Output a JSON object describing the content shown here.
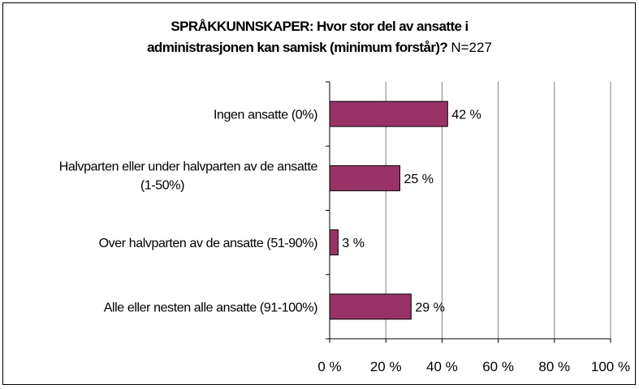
{
  "chart_data": {
    "type": "bar",
    "orientation": "horizontal",
    "title": "SPRÅKKUNNSKAPER: Hvor stor del av ansatte i administrasjonen kan samisk (minimum forstår)?",
    "title_line1": "SPRÅKKUNNSKAPER: Hvor stor del av ansatte i",
    "title_line2": "administrasjonen kan samisk (minimum forstår)?",
    "subtitle": "N=227",
    "categories": [
      [
        "Ingen ansatte (0%)"
      ],
      [
        "Halvparten eller under halvparten av de ansatte",
        "(1-50%)"
      ],
      [
        "Over halvparten av de ansatte (51-90%)"
      ],
      [
        "Alle eller nesten alle ansatte (91-100%)"
      ]
    ],
    "values": [
      42,
      25,
      3,
      29
    ],
    "data_labels": [
      "42 %",
      "25 %",
      "3 %",
      "29 %"
    ],
    "xlim": [
      0,
      100
    ],
    "xticks": [
      0,
      20,
      40,
      60,
      80,
      100
    ],
    "xtick_labels": [
      "0 %",
      "20 %",
      "40 %",
      "60 %",
      "80 %",
      "100 %"
    ],
    "grid": "vertical",
    "bar_color": "#993366",
    "legend": "none"
  }
}
